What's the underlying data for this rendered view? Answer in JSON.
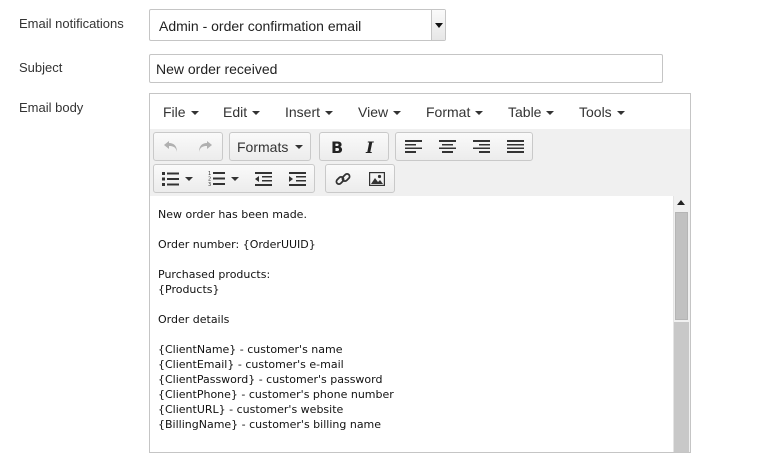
{
  "labels": {
    "notifications": "Email notifications",
    "subject": "Subject",
    "body": "Email body"
  },
  "notification_select": {
    "value": "Admin - order confirmation email"
  },
  "subject": {
    "value": "New order received"
  },
  "editor": {
    "menu": [
      "File",
      "Edit",
      "Insert",
      "View",
      "Format",
      "Table",
      "Tools"
    ],
    "formats_label": "Formats",
    "lines": [
      "New order has been made.",
      "",
      "Order number: {OrderUUID}",
      "",
      "Purchased products:",
      "{Products}",
      "",
      "Order details",
      "",
      "{ClientName} - customer's name",
      "{ClientEmail} - customer's e-mail",
      "{ClientPassword} - customer's password",
      "{ClientPhone} - customer's phone number",
      "{ClientURL} - customer's website",
      "{BillingName} - customer's billing name"
    ]
  },
  "icons": {
    "undo": "undo-icon",
    "redo": "redo-icon",
    "bold": "bold-icon",
    "italic": "italic-icon",
    "align_left": "align-left-icon",
    "align_center": "align-center-icon",
    "align_right": "align-right-icon",
    "align_justify": "align-justify-icon",
    "bullet_list": "bullet-list-icon",
    "numbered_list": "numbered-list-icon",
    "outdent": "outdent-icon",
    "indent": "indent-icon",
    "link": "link-icon",
    "image": "image-icon"
  }
}
